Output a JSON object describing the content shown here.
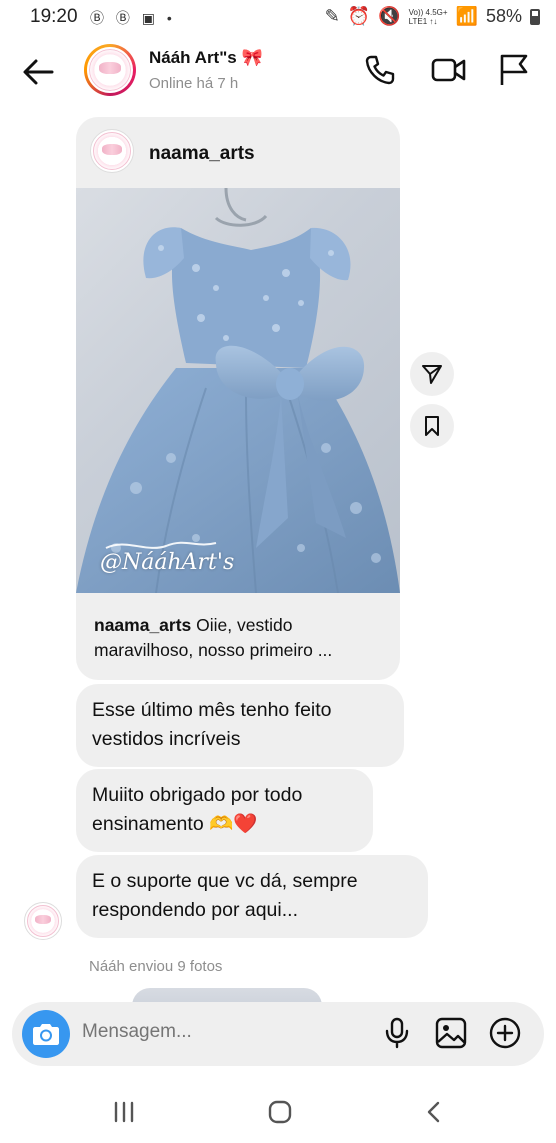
{
  "status_bar": {
    "time": "19:20",
    "network_line1": "Vo)) 4.5G+",
    "network_line2": "LTE1 ↑↓",
    "battery": "58%"
  },
  "header": {
    "contact_name": "Nááh Art\"s 🎀",
    "presence": "Online há 7 h"
  },
  "post": {
    "username": "naama_arts",
    "watermark": "@NááhArt's",
    "caption_user": "naama_arts",
    "caption_text": " Oiie, vestido maravilhoso, nosso primeiro ..."
  },
  "messages": [
    {
      "text": "Esse último mês tenho feito vestidos incríveis"
    },
    {
      "text": "Muiito obrigado por todo ensinamento 🫶❤️"
    },
    {
      "text": "E o suporte que vc dá, sempre respondendo por aqui..."
    }
  ],
  "sent_note": "Nááh enviou 9 fotos",
  "composer": {
    "placeholder": "Mensagem..."
  },
  "colors": {
    "bubble": "#efefef",
    "camera_button": "#3797f0",
    "muted_text": "#8e8e8e",
    "dress_blue": "#7f9fc4"
  },
  "icons": [
    "back-arrow-icon",
    "phone-icon",
    "video-icon",
    "flag-icon",
    "share-icon",
    "bookmark-icon",
    "camera-icon",
    "microphone-icon",
    "gallery-icon",
    "add-icon",
    "recents-icon",
    "home-icon",
    "nav-back-icon"
  ]
}
